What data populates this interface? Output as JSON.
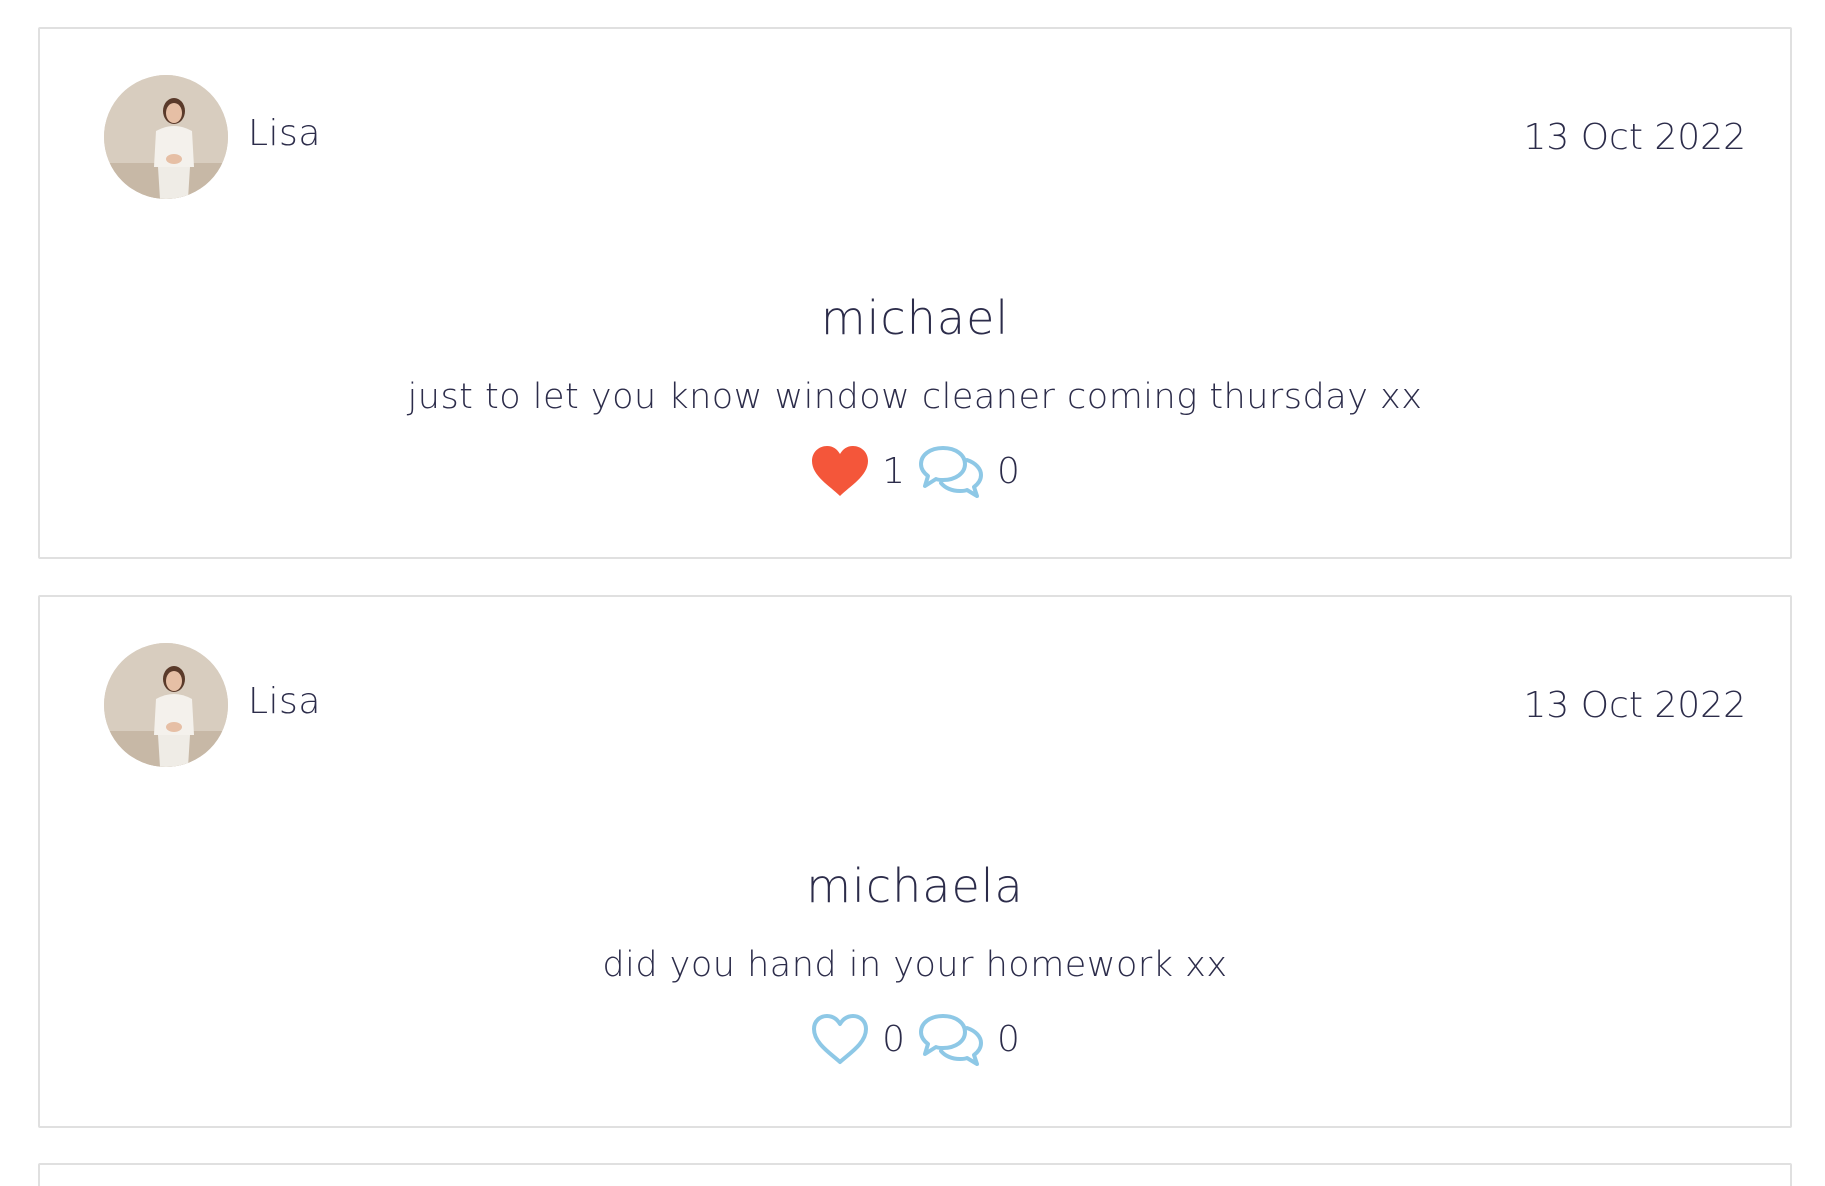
{
  "posts": [
    {
      "author": "Lisa",
      "date": "13 Oct 2022",
      "title": "michael",
      "body": "just to let you know window cleaner coming thursday xx",
      "likes": "1",
      "liked": true,
      "comments": "0"
    },
    {
      "author": "Lisa",
      "date": "13 Oct 2022",
      "title": "michaela",
      "body": "did you hand in your homework xx",
      "likes": "0",
      "liked": false,
      "comments": "0"
    }
  ],
  "colors": {
    "heart_filled": "#f4563a",
    "icon_outline": "#8ec8e6",
    "text": "#2c2c4a",
    "border": "#e0e0e0"
  },
  "icons": {
    "like_filled": "heart-filled-icon",
    "like_outline": "heart-outline-icon",
    "comment": "speech-bubbles-icon"
  }
}
